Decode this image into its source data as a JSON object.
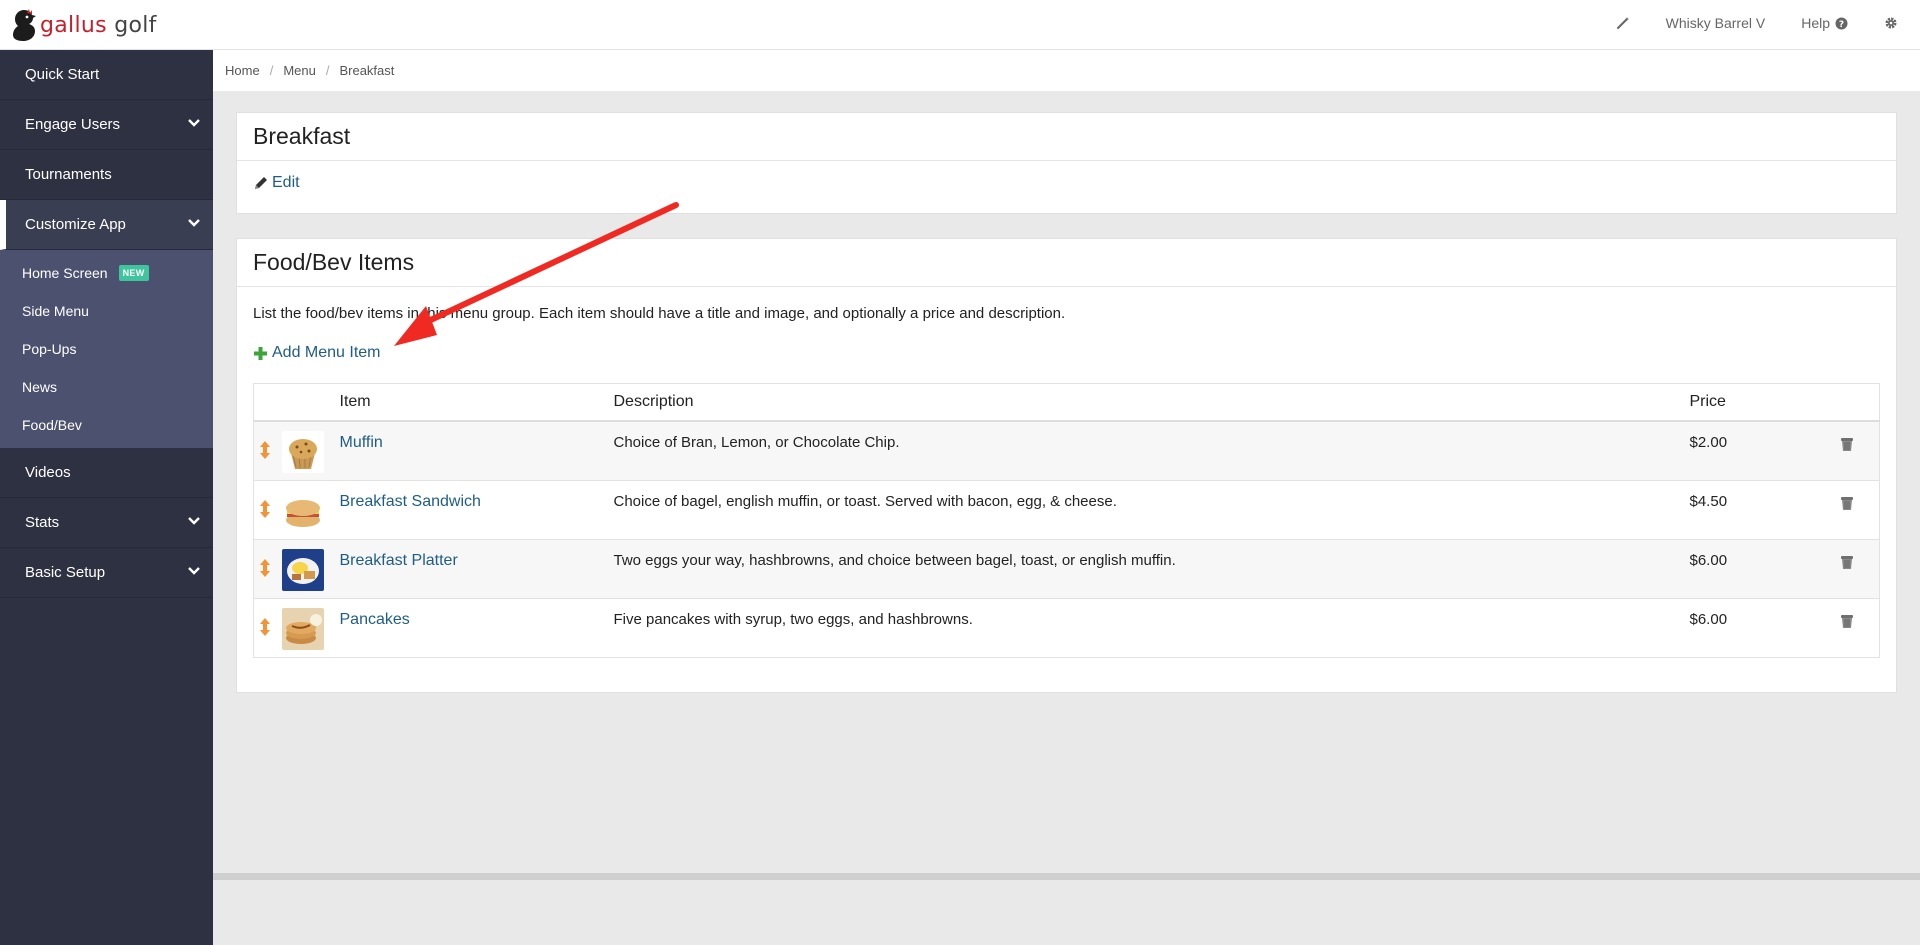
{
  "brand": {
    "name_part1": "gallus",
    "name_part2": "golf"
  },
  "topbar": {
    "magic_icon": "magic-wand-icon",
    "account": "Whisky Barrel V",
    "help": "Help",
    "settings_icon": "gear-icon"
  },
  "sidebar": {
    "items": [
      {
        "label": "Quick Start"
      },
      {
        "label": "Engage Users"
      },
      {
        "label": "Tournaments"
      },
      {
        "label": "Customize App"
      },
      {
        "label": "Videos"
      },
      {
        "label": "Stats"
      },
      {
        "label": "Basic Setup"
      }
    ],
    "subitems": [
      {
        "label": "Home Screen",
        "badge": "NEW"
      },
      {
        "label": "Side Menu"
      },
      {
        "label": "Pop-Ups"
      },
      {
        "label": "News"
      },
      {
        "label": "Food/Bev"
      }
    ]
  },
  "breadcrumb": {
    "items": [
      "Home",
      "Menu",
      "Breakfast"
    ]
  },
  "group_panel": {
    "title": "Breakfast",
    "edit_label": "Edit"
  },
  "items_panel": {
    "title": "Food/Bev Items",
    "description": "List the food/bev items in this menu group. Each item should have a title and image, and optionally a price and description.",
    "add_label": "Add Menu Item",
    "columns": {
      "item": "Item",
      "description": "Description",
      "price": "Price"
    },
    "rows": [
      {
        "name": "Muffin",
        "description": "Choice of Bran, Lemon, or Chocolate Chip.",
        "price": "$2.00"
      },
      {
        "name": "Breakfast Sandwich",
        "description": "Choice of bagel, english muffin, or toast. Served with bacon, egg, & cheese.",
        "price": "$4.50"
      },
      {
        "name": "Breakfast Platter",
        "description": "Two eggs your way, hashbrowns, and choice between bagel, toast, or english muffin.",
        "price": "$6.00"
      },
      {
        "name": "Pancakes",
        "description": "Five pancakes with syrup, two eggs, and hashbrowns.",
        "price": "$6.00"
      }
    ]
  },
  "colors": {
    "sidebar": "#2e3142",
    "subnav": "#4c5170",
    "link": "#1f5d86",
    "brand_red": "#c8202a",
    "annotation": "#f02a22"
  }
}
